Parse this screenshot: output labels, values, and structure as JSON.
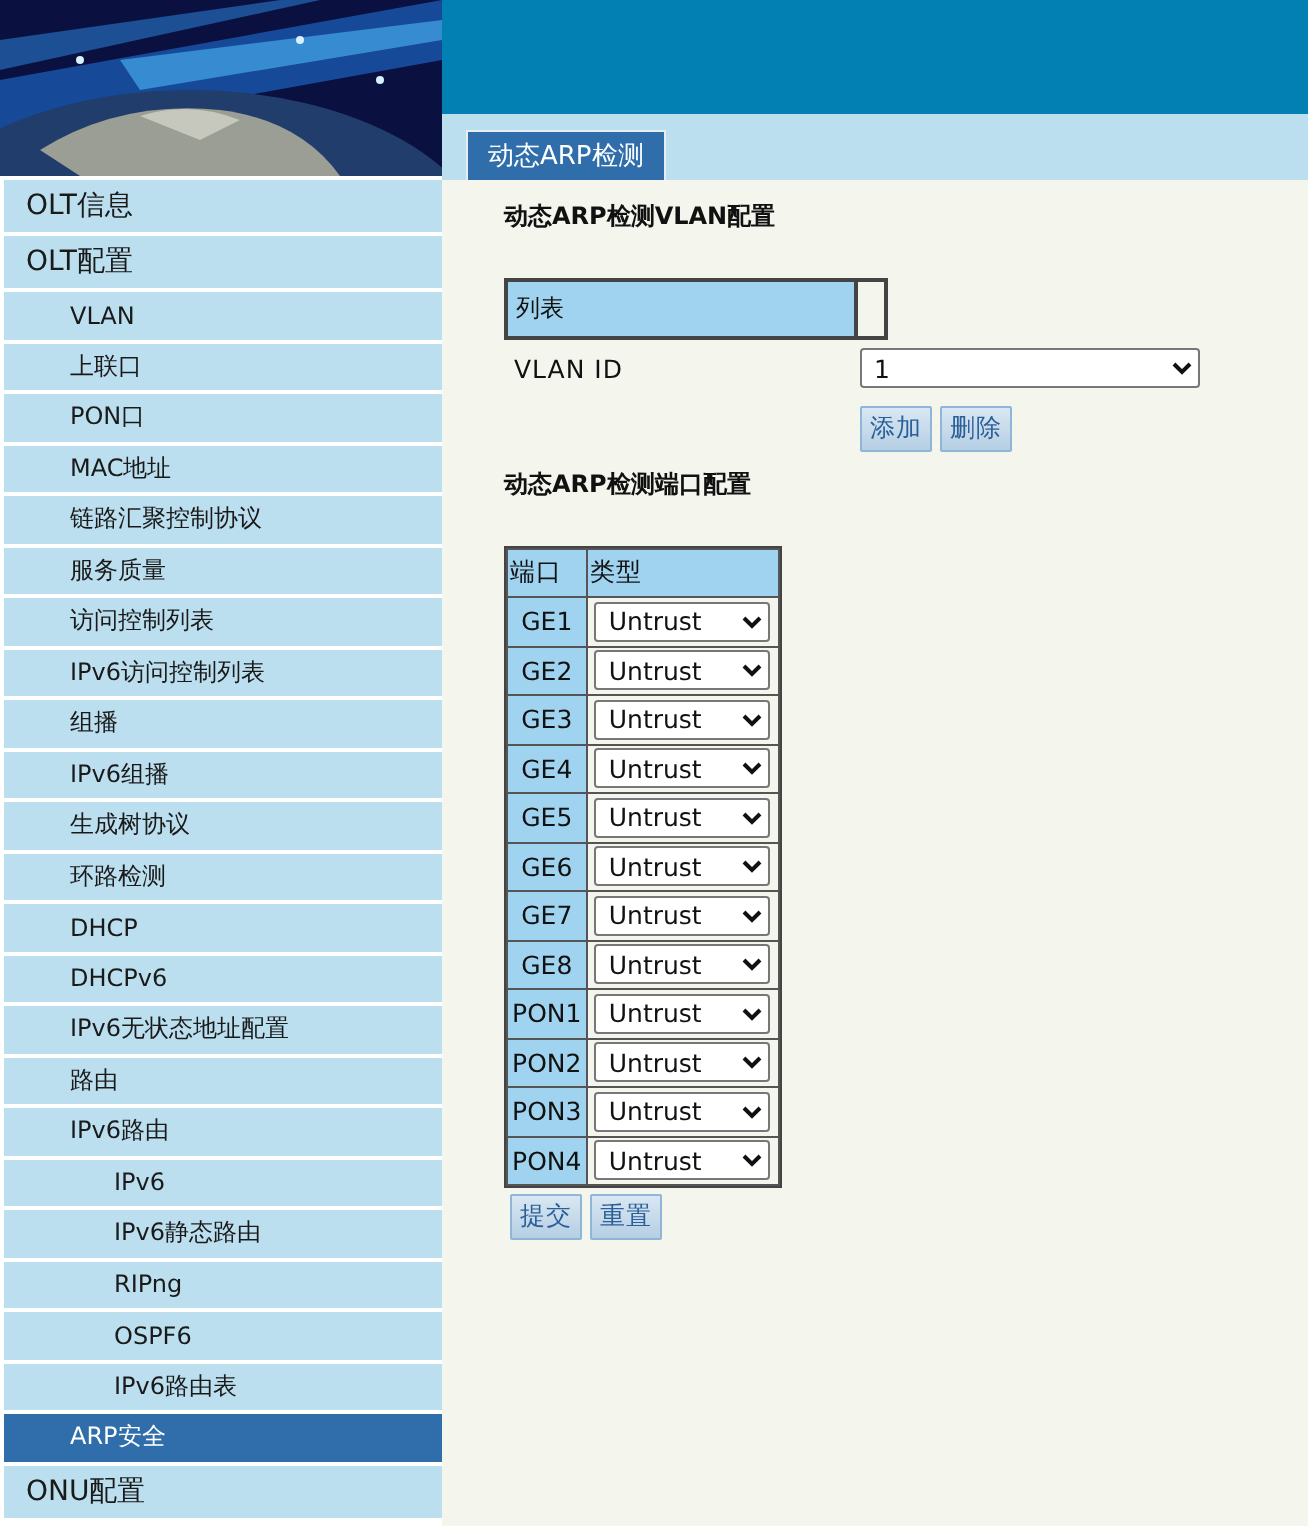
{
  "sidebar": {
    "items": [
      {
        "label": "OLT信息",
        "selected": false
      },
      {
        "label": "OLT配置",
        "selected": false,
        "children": [
          {
            "label": "VLAN",
            "selected": false
          },
          {
            "label": "上联口",
            "selected": false
          },
          {
            "label": "PON口",
            "selected": false
          },
          {
            "label": "MAC地址",
            "selected": false
          },
          {
            "label": "链路汇聚控制协议",
            "selected": false
          },
          {
            "label": "服务质量",
            "selected": false
          },
          {
            "label": "访问控制列表",
            "selected": false
          },
          {
            "label": "IPv6访问控制列表",
            "selected": false
          },
          {
            "label": "组播",
            "selected": false
          },
          {
            "label": "IPv6组播",
            "selected": false
          },
          {
            "label": "生成树协议",
            "selected": false
          },
          {
            "label": "环路检测",
            "selected": false
          },
          {
            "label": "DHCP",
            "selected": false
          },
          {
            "label": "DHCPv6",
            "selected": false
          },
          {
            "label": "IPv6无状态地址配置",
            "selected": false
          },
          {
            "label": "路由",
            "selected": false
          },
          {
            "label": "IPv6路由",
            "selected": false,
            "children": [
              {
                "label": "IPv6",
                "selected": false
              },
              {
                "label": "IPv6静态路由",
                "selected": false
              },
              {
                "label": "RIPng",
                "selected": false
              },
              {
                "label": "OSPF6",
                "selected": false
              },
              {
                "label": "IPv6路由表",
                "selected": false
              }
            ]
          },
          {
            "label": "ARP安全",
            "selected": true
          }
        ]
      },
      {
        "label": "ONU配置",
        "selected": false
      }
    ]
  },
  "tabs": [
    {
      "label": "动态ARP检测",
      "selected": true
    }
  ],
  "vlan_section": {
    "title": "动态ARP检测VLAN配置",
    "list_header": "列表",
    "field_label": "VLAN ID",
    "vlan_value": "1",
    "buttons": [
      "添加",
      "删除"
    ]
  },
  "port_section": {
    "title": "动态ARP检测端口配置",
    "columns": [
      "端口",
      "类型"
    ],
    "rows": [
      {
        "port": "GE1",
        "type": "Untrust"
      },
      {
        "port": "GE2",
        "type": "Untrust"
      },
      {
        "port": "GE3",
        "type": "Untrust"
      },
      {
        "port": "GE4",
        "type": "Untrust"
      },
      {
        "port": "GE5",
        "type": "Untrust"
      },
      {
        "port": "GE6",
        "type": "Untrust"
      },
      {
        "port": "GE7",
        "type": "Untrust"
      },
      {
        "port": "GE8",
        "type": "Untrust"
      },
      {
        "port": "PON1",
        "type": "Untrust"
      },
      {
        "port": "PON2",
        "type": "Untrust"
      },
      {
        "port": "PON3",
        "type": "Untrust"
      },
      {
        "port": "PON4",
        "type": "Untrust"
      }
    ],
    "buttons": [
      "提交",
      "重置"
    ]
  }
}
